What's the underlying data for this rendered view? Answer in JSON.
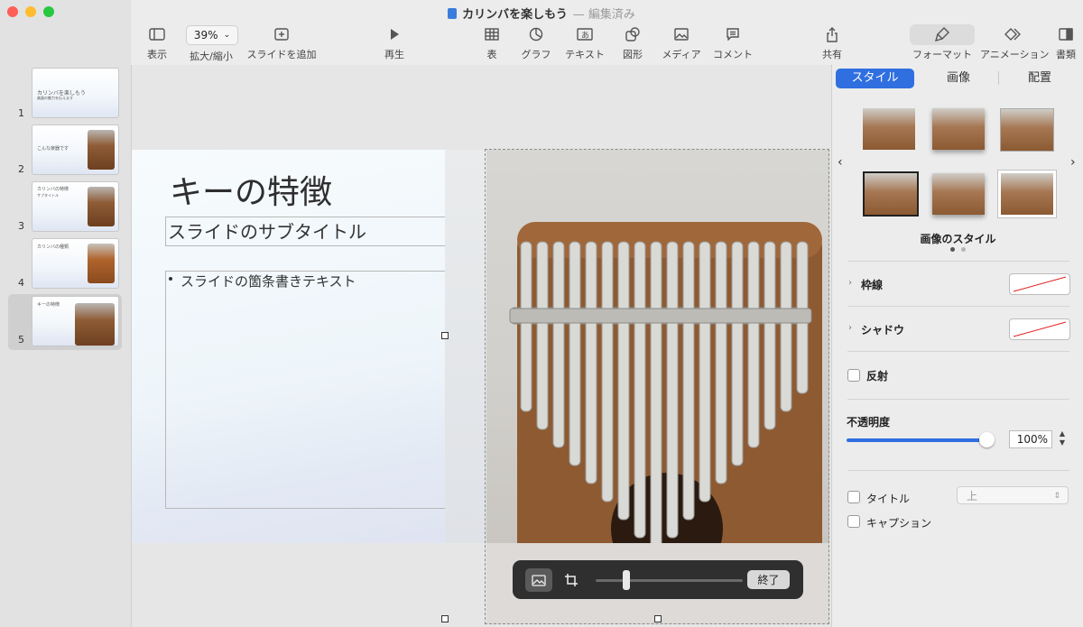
{
  "window": {
    "title": "カリンバを楽しもう",
    "status": "— 編集済み"
  },
  "toolbar": {
    "view": "表示",
    "zoom_value": "39%",
    "zoom_label": "拡大/縮小",
    "add_slide": "スライドを追加",
    "play": "再生",
    "table": "表",
    "chart": "グラフ",
    "text": "テキスト",
    "shape": "図形",
    "media": "メディア",
    "comment": "コメント",
    "share": "共有",
    "format": "フォーマット",
    "animate": "アニメーション",
    "document": "書類"
  },
  "navigator": {
    "slides": [
      {
        "num": "1",
        "title": "カリンバを楽しもう",
        "sub": "楽器の魅力を伝えます"
      },
      {
        "num": "2",
        "title": "こんな楽器です"
      },
      {
        "num": "3",
        "title": "カリンバの特徴",
        "sub": "サブタイトル"
      },
      {
        "num": "4",
        "title": "カリンバの種類"
      },
      {
        "num": "5",
        "title": "キーの特徴"
      }
    ]
  },
  "slide": {
    "title": "キーの特徴",
    "subtitle": "スライドのサブタイトル",
    "bullet": "スライドの箇条書きテキスト"
  },
  "mask_bar": {
    "done": "終了"
  },
  "inspector": {
    "tabs": [
      "スタイル",
      "画像",
      "配置"
    ],
    "image_styles_label": "画像のスタイル",
    "border": "枠線",
    "shadow": "シャドウ",
    "reflection": "反射",
    "opacity_label": "不透明度",
    "opacity_value": "100%",
    "title_label": "タイトル",
    "title_position": "上",
    "caption_label": "キャプション"
  },
  "colors": {
    "accent": "#2f6fe0",
    "wood": "#8b5a32"
  }
}
